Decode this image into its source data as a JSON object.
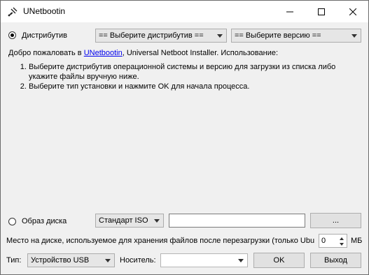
{
  "window": {
    "title": "UNetbootin"
  },
  "distribution": {
    "radio_label": "Дистрибутив",
    "distro_select": "== Выберите дистрибутив ==",
    "version_select": "== Выберите версию =="
  },
  "welcome": {
    "prefix": "Добро пожаловать в ",
    "link": "UNetbootin",
    "suffix": ", Universal Netboot Installer. Использование:"
  },
  "instructions": [
    "Выберите дистрибутив операционной системы и версию для загрузки из списка либо укажите файлы вручную ниже.",
    "Выберите тип установки и нажмите OK для начала процесса."
  ],
  "disk_image": {
    "radio_label": "Образ диска",
    "type_select": "Стандарт ISO",
    "path_value": "",
    "browse_label": "..."
  },
  "space": {
    "label": "Место на диске, используемое для хранения файлов после перезагрузки (только Ubu",
    "value": "0",
    "unit": "МБ"
  },
  "bottom": {
    "type_label": "Тип:",
    "type_select": "Устройство USB",
    "media_label": "Носитель:",
    "media_select": "",
    "ok_label": "OK",
    "exit_label": "Выход"
  }
}
